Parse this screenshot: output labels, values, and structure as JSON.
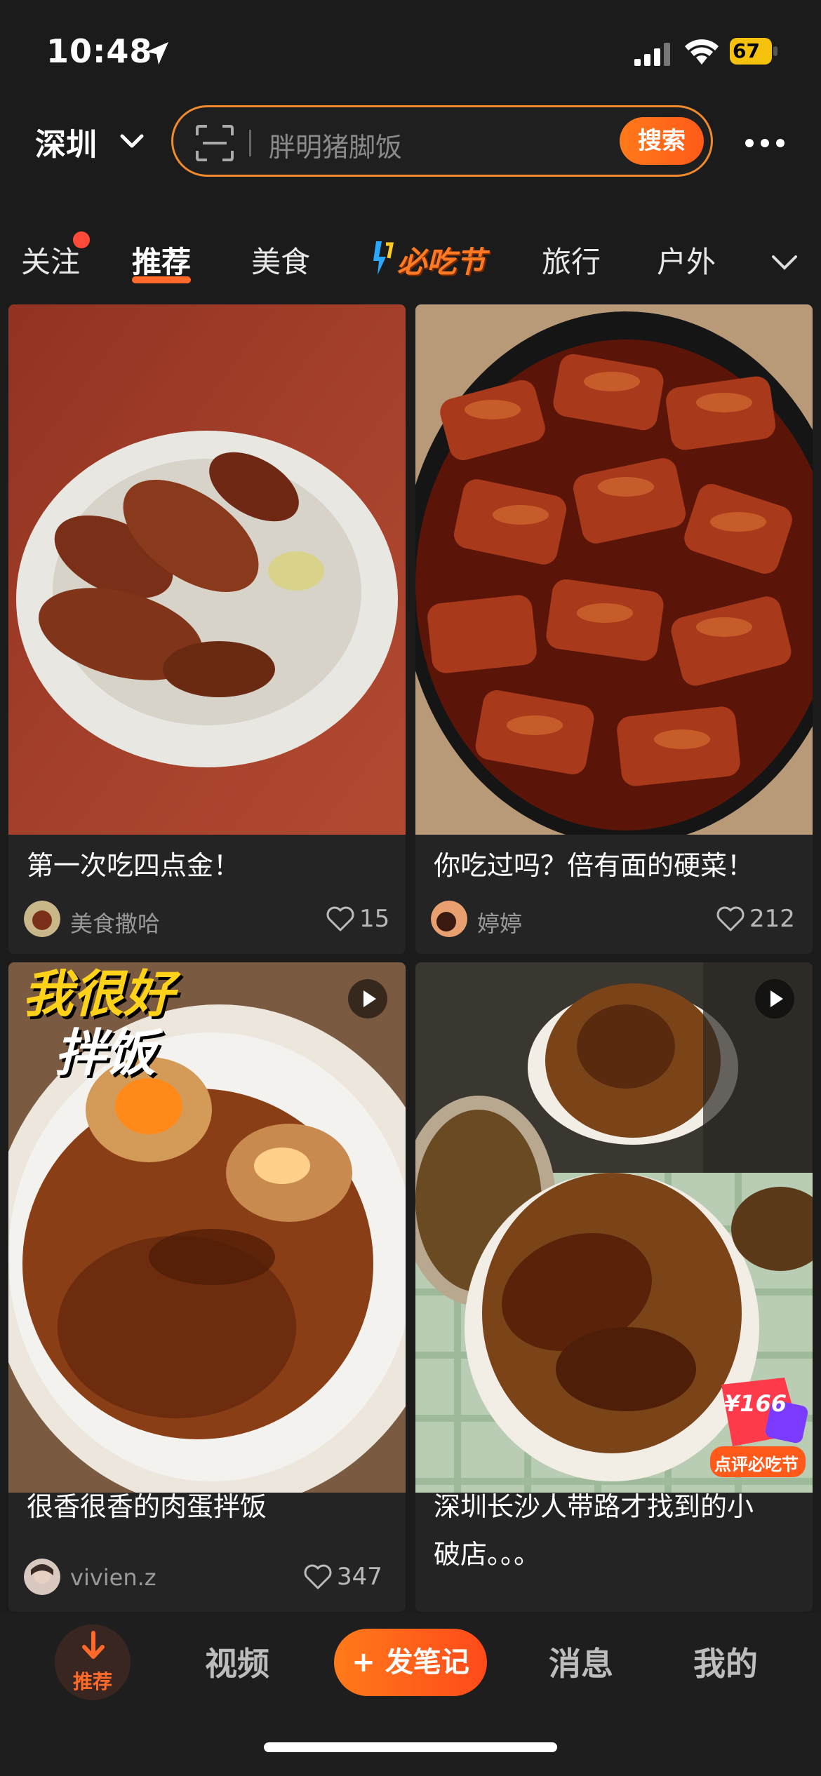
{
  "status_bar": {
    "time": "10:48",
    "battery": "67"
  },
  "header": {
    "city": "深圳",
    "search_placeholder": "胖明猪脚饭",
    "search_button": "搜索"
  },
  "tabs": [
    {
      "label": "关注"
    },
    {
      "label": "推荐"
    },
    {
      "label": "美食"
    },
    {
      "label": "必吃节"
    },
    {
      "label": "旅行"
    },
    {
      "label": "户外"
    }
  ],
  "feed": [
    {
      "title": "第一次吃四点金！",
      "author": "美食撒哈",
      "likes": "15"
    },
    {
      "title": "你吃过吗？倍有面的硬菜！",
      "author": "婷婷",
      "likes": "212"
    },
    {
      "title": "很香很香的肉蛋拌饭",
      "author": "vivien.z",
      "likes": "347",
      "overlay": [
        "我很好",
        "拌饭"
      ]
    },
    {
      "title_line1": "深圳长沙人带路才找到的小",
      "title_line2": "破店。。。",
      "badge_price": "¥166",
      "badge_label": "点评必吃节"
    }
  ],
  "bottom_nav": {
    "recommend": "推荐",
    "video": "视频",
    "post": "+ 发笔记",
    "messages": "消息",
    "me": "我的"
  },
  "colors": {
    "accent": "#ff6a2a",
    "background": "#1b1b1b",
    "battery": "#f4c20d"
  }
}
